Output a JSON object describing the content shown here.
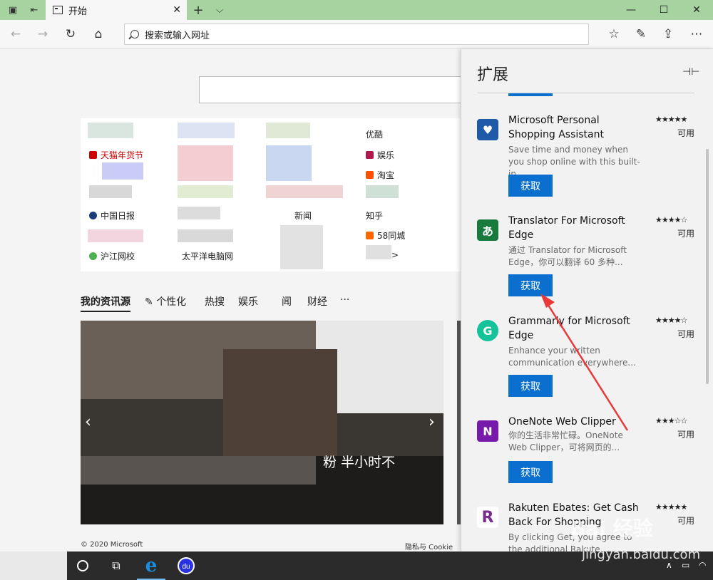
{
  "browser": {
    "tab_title": "开始",
    "tab_close": "✕",
    "new_tab": "+",
    "tab_list": "⌵",
    "address_placeholder": "搜索或输入网址",
    "window_minimize": "—",
    "window_maximize": "☐",
    "window_close": "✕",
    "icons": [
      "tab-set-aside-icon",
      "restore-tabs-icon",
      "back-icon",
      "forward-icon",
      "refresh-icon",
      "home-icon",
      "favorites-icon",
      "notes-icon",
      "share-icon",
      "more-icon"
    ]
  },
  "top_sites": [
    {
      "label": "优酷",
      "color": "#cccccc"
    },
    {
      "label": "天猫年货节",
      "color": "#cc0000"
    },
    {
      "label": "娱乐",
      "color": "#b0174c"
    },
    {
      "label": "淘宝",
      "color": "#ff5000"
    },
    {
      "label": "中国日报",
      "color": "#1a3c7a"
    },
    {
      "label": "新闻",
      "color": "#d22"
    },
    {
      "label": "知乎",
      "color": "#cccccc"
    },
    {
      "label": "58同城",
      "color": "#f60"
    },
    {
      "label": "沪江网校",
      "color": "#4caf50"
    },
    {
      "label": "太平洋电脑网",
      "color": "#cccccc"
    },
    {
      "label": ">",
      "color": "#cccccc"
    }
  ],
  "news_tabs": [
    "我的资讯源",
    "个性化",
    "热搜",
    "娱乐",
    "闻",
    "财经",
    "···"
  ],
  "hero_caption": "粉 半小时不",
  "footer": {
    "copyright": "© 2020 Microsoft",
    "privacy": "隐私与 Cookie"
  },
  "panel": {
    "title": "扩展",
    "pin_icon": "⊣⊢",
    "extensions": [
      {
        "name": "Microsoft Personal Shopping Assistant",
        "rating": "★★★★★",
        "status": "可用",
        "desc": "Save time and money when you shop online with this built-in...",
        "button": "获取",
        "logo_color": "#1e5aa8",
        "logo": "♥"
      },
      {
        "name": "Translator For Microsoft Edge",
        "rating": "★★★★☆",
        "status": "可用",
        "desc": "通过 Translator for Microsoft Edge，你可以翻译 60 多种...",
        "button": "获取",
        "logo_color": "#187a3c",
        "logo": "あ"
      },
      {
        "name": "Grammarly for Microsoft Edge",
        "rating": "★★★★☆",
        "status": "可用",
        "desc": "Enhance your written communication everywhere...",
        "button": "获取",
        "logo_color": "#15c39a",
        "logo": "G"
      },
      {
        "name": "OneNote Web Clipper",
        "rating": "★★★☆☆",
        "status": "可用",
        "desc": "你的生活非常忙碌。OneNote Web Clipper，可将网页的...",
        "button": "获取",
        "logo_color": "#7719aa",
        "logo": "N"
      },
      {
        "name": "Rakuten Ebates: Get Cash Back For Shopping",
        "rating": "★★★★★",
        "status": "可用",
        "desc": "By clicking Get, you agree to the additional Rakute...",
        "button": "",
        "logo_color": "#ffffff",
        "logo": "R"
      }
    ]
  },
  "taskbar": {
    "items": [
      "cortana-icon",
      "task-view-icon",
      "edge-icon",
      "baidu-icon"
    ]
  },
  "watermark": {
    "text": "Bai 经验",
    "sub": "jingyan.baidu.com"
  }
}
